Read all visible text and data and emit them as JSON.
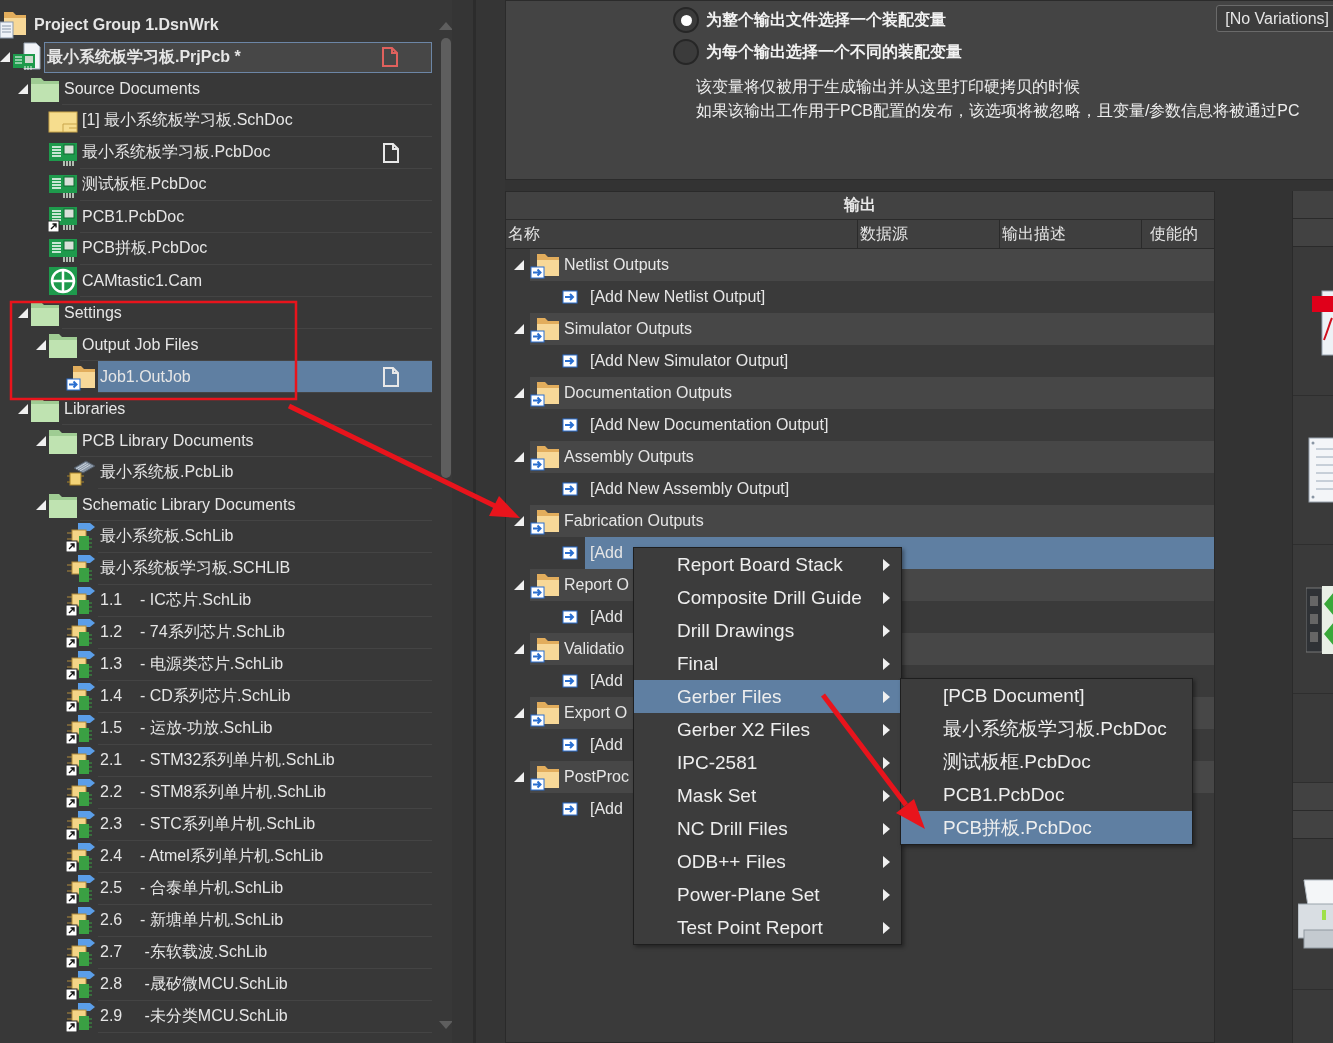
{
  "tree": {
    "items": [
      {
        "label": "Project Group 1.DsnWrk",
        "kind": "group",
        "selected": false,
        "children": [
          {
            "label": "最小系统板学习板.PrjPcb *",
            "kind": "project",
            "expanded": true,
            "selected": true,
            "open": true,
            "modified": true,
            "children": [
              {
                "label": "Source Documents",
                "kind": "folder",
                "expanded": true,
                "selected": false,
                "children": [
                  {
                    "label": "[1] 最小系统板学习板.SchDoc",
                    "kind": "schdoc",
                    "selected": false,
                    "shortcut": false
                  },
                  {
                    "label": "最小系统板学习板.PcbDoc",
                    "kind": "pcbdoc",
                    "selected": false,
                    "shortcut": false,
                    "open": true,
                    "modified": false
                  },
                  {
                    "label": "测试板框.PcbDoc",
                    "kind": "pcbdoc",
                    "selected": false,
                    "shortcut": false
                  },
                  {
                    "label": "PCB1.PcbDoc",
                    "kind": "pcbdoc",
                    "selected": false,
                    "shortcut": true
                  },
                  {
                    "label": "PCB拼板.PcbDoc",
                    "kind": "pcbdoc",
                    "selected": false,
                    "shortcut": false
                  },
                  {
                    "label": "CAMtastic1.Cam",
                    "kind": "cam",
                    "selected": false,
                    "shortcut": false
                  }
                ]
              },
              {
                "label": "Settings",
                "kind": "folder",
                "expanded": true,
                "selected": false,
                "children": [
                  {
                    "label": "Output Job Files",
                    "kind": "folder",
                    "expanded": true,
                    "selected": false,
                    "children": [
                      {
                        "label": "Job1.OutJob",
                        "kind": "outjob",
                        "selected": true,
                        "shortcut": false,
                        "open": true,
                        "modified": false
                      }
                    ]
                  }
                ]
              },
              {
                "label": "Libraries",
                "kind": "folder",
                "expanded": true,
                "selected": false,
                "children": [
                  {
                    "label": "PCB Library Documents",
                    "kind": "folder",
                    "expanded": true,
                    "selected": false,
                    "children": [
                      {
                        "label": "最小系统板.PcbLib",
                        "kind": "pcblib",
                        "selected": false,
                        "shortcut": false
                      }
                    ]
                  },
                  {
                    "label": "Schematic Library Documents",
                    "kind": "folder",
                    "expanded": true,
                    "selected": false,
                    "children": [
                      {
                        "label": "最小系统板.SchLib",
                        "kind": "schlib",
                        "selected": false,
                        "shortcut": true
                      },
                      {
                        "label": "最小系统板学习板.SCHLIB",
                        "kind": "schlib",
                        "selected": false,
                        "shortcut": false
                      },
                      {
                        "label": "1.1    - IC芯片.SchLib",
                        "kind": "schlib",
                        "selected": false,
                        "shortcut": true
                      },
                      {
                        "label": "1.2    - 74系列芯片.SchLib",
                        "kind": "schlib",
                        "selected": false,
                        "shortcut": true
                      },
                      {
                        "label": "1.3    - 电源类芯片.SchLib",
                        "kind": "schlib",
                        "selected": false,
                        "shortcut": true
                      },
                      {
                        "label": "1.4    - CD系列芯片.SchLib",
                        "kind": "schlib",
                        "selected": false,
                        "shortcut": true
                      },
                      {
                        "label": "1.5    - 运放-功放.SchLib",
                        "kind": "schlib",
                        "selected": false,
                        "shortcut": true
                      },
                      {
                        "label": "2.1    - STM32系列单片机.SchLib",
                        "kind": "schlib",
                        "selected": false,
                        "shortcut": true
                      },
                      {
                        "label": "2.2    - STM8系列单片机.SchLib",
                        "kind": "schlib",
                        "selected": false,
                        "shortcut": true
                      },
                      {
                        "label": "2.3    - STC系列单片机.SchLib",
                        "kind": "schlib",
                        "selected": false,
                        "shortcut": true
                      },
                      {
                        "label": "2.4    - Atmel系列单片机.SchLib",
                        "kind": "schlib",
                        "selected": false,
                        "shortcut": true
                      },
                      {
                        "label": "2.5    - 合泰单片机.SchLib",
                        "kind": "schlib",
                        "selected": false,
                        "shortcut": true
                      },
                      {
                        "label": "2.6    - 新塘单片机.SchLib",
                        "kind": "schlib",
                        "selected": false,
                        "shortcut": true
                      },
                      {
                        "label": "2.7     -东软载波.SchLib",
                        "kind": "schlib",
                        "selected": false,
                        "shortcut": true
                      },
                      {
                        "label": "2.8     -晟矽微MCU.SchLib",
                        "kind": "schlib",
                        "selected": false,
                        "shortcut": true
                      },
                      {
                        "label": "2.9     -未分类MCU.SchLib",
                        "kind": "schlib",
                        "selected": false,
                        "shortcut": true
                      }
                    ]
                  }
                ]
              }
            ]
          }
        ]
      }
    ]
  },
  "variant_options": {
    "radios": [
      {
        "label": "为整个输出文件选择一个装配变量",
        "selected": true
      },
      {
        "label": "为每个输出选择一个不同的装配变量",
        "selected": false
      }
    ],
    "variant_button": "[No Variations]",
    "note_lines": [
      "该变量将仅被用于生成输出并从这里打印硬拷贝的时候",
      "如果该输出工作用于PCB配置的发布，该选项将被忽略，且变量/参数信息将被通过PC"
    ]
  },
  "outputs": {
    "title": "输出",
    "columns": [
      "名称",
      "数据源",
      "输出描述",
      "使能的"
    ],
    "groups": [
      {
        "name": "Netlist Outputs",
        "expanded": true,
        "add_item": {
          "label": "[Add New Netlist Output]",
          "selected": false
        }
      },
      {
        "name": "Simulator Outputs",
        "expanded": true,
        "add_item": {
          "label": "[Add New Simulator Output]",
          "selected": false
        }
      },
      {
        "name": "Documentation Outputs",
        "expanded": true,
        "add_item": {
          "label": "[Add New Documentation Output]",
          "selected": false
        }
      },
      {
        "name": "Assembly Outputs",
        "expanded": true,
        "add_item": {
          "label": "[Add New Assembly Output]",
          "selected": false
        }
      },
      {
        "name": "Fabrication Outputs",
        "expanded": true,
        "add_item": {
          "label": "[Add",
          "selected": true
        }
      },
      {
        "name": "Report O",
        "expanded": true,
        "add_item": {
          "label": "[Add",
          "selected": false
        }
      },
      {
        "name": "Validatio",
        "expanded": true,
        "add_item": {
          "label": "[Add",
          "selected": false
        }
      },
      {
        "name": "Export O",
        "expanded": true,
        "add_item": {
          "label": "[Add",
          "selected": false
        }
      },
      {
        "name": "PostProc",
        "expanded": true,
        "add_item": {
          "label": "[Add",
          "selected": false
        }
      }
    ]
  },
  "context_menu": {
    "items": [
      {
        "label": "Report Board Stack",
        "has_submenu": true,
        "selected": false
      },
      {
        "label": "Composite Drill Guide",
        "has_submenu": true,
        "selected": false
      },
      {
        "label": "Drill Drawings",
        "has_submenu": true,
        "selected": false
      },
      {
        "label": "Final",
        "has_submenu": true,
        "selected": false
      },
      {
        "label": "Gerber Files",
        "has_submenu": true,
        "selected": true
      },
      {
        "label": "Gerber X2 Files",
        "has_submenu": true,
        "selected": false
      },
      {
        "label": "IPC-2581",
        "has_submenu": true,
        "selected": false
      },
      {
        "label": "Mask Set",
        "has_submenu": true,
        "selected": false
      },
      {
        "label": "NC Drill Files",
        "has_submenu": true,
        "selected": false
      },
      {
        "label": "ODB++ Files",
        "has_submenu": true,
        "selected": false
      },
      {
        "label": "Power-Plane Set",
        "has_submenu": true,
        "selected": false
      },
      {
        "label": "Test Point Report",
        "has_submenu": true,
        "selected": false
      }
    ]
  },
  "submenu": {
    "items": [
      {
        "label": "[PCB Document]",
        "selected": false
      },
      {
        "label": "最小系统板学习板.PcbDoc",
        "selected": false
      },
      {
        "label": "测试板框.PcbDoc",
        "selected": false
      },
      {
        "label": "PCB1.PcbDoc",
        "selected": false
      },
      {
        "label": "PCB拼板.PcbDoc",
        "selected": true
      }
    ]
  }
}
